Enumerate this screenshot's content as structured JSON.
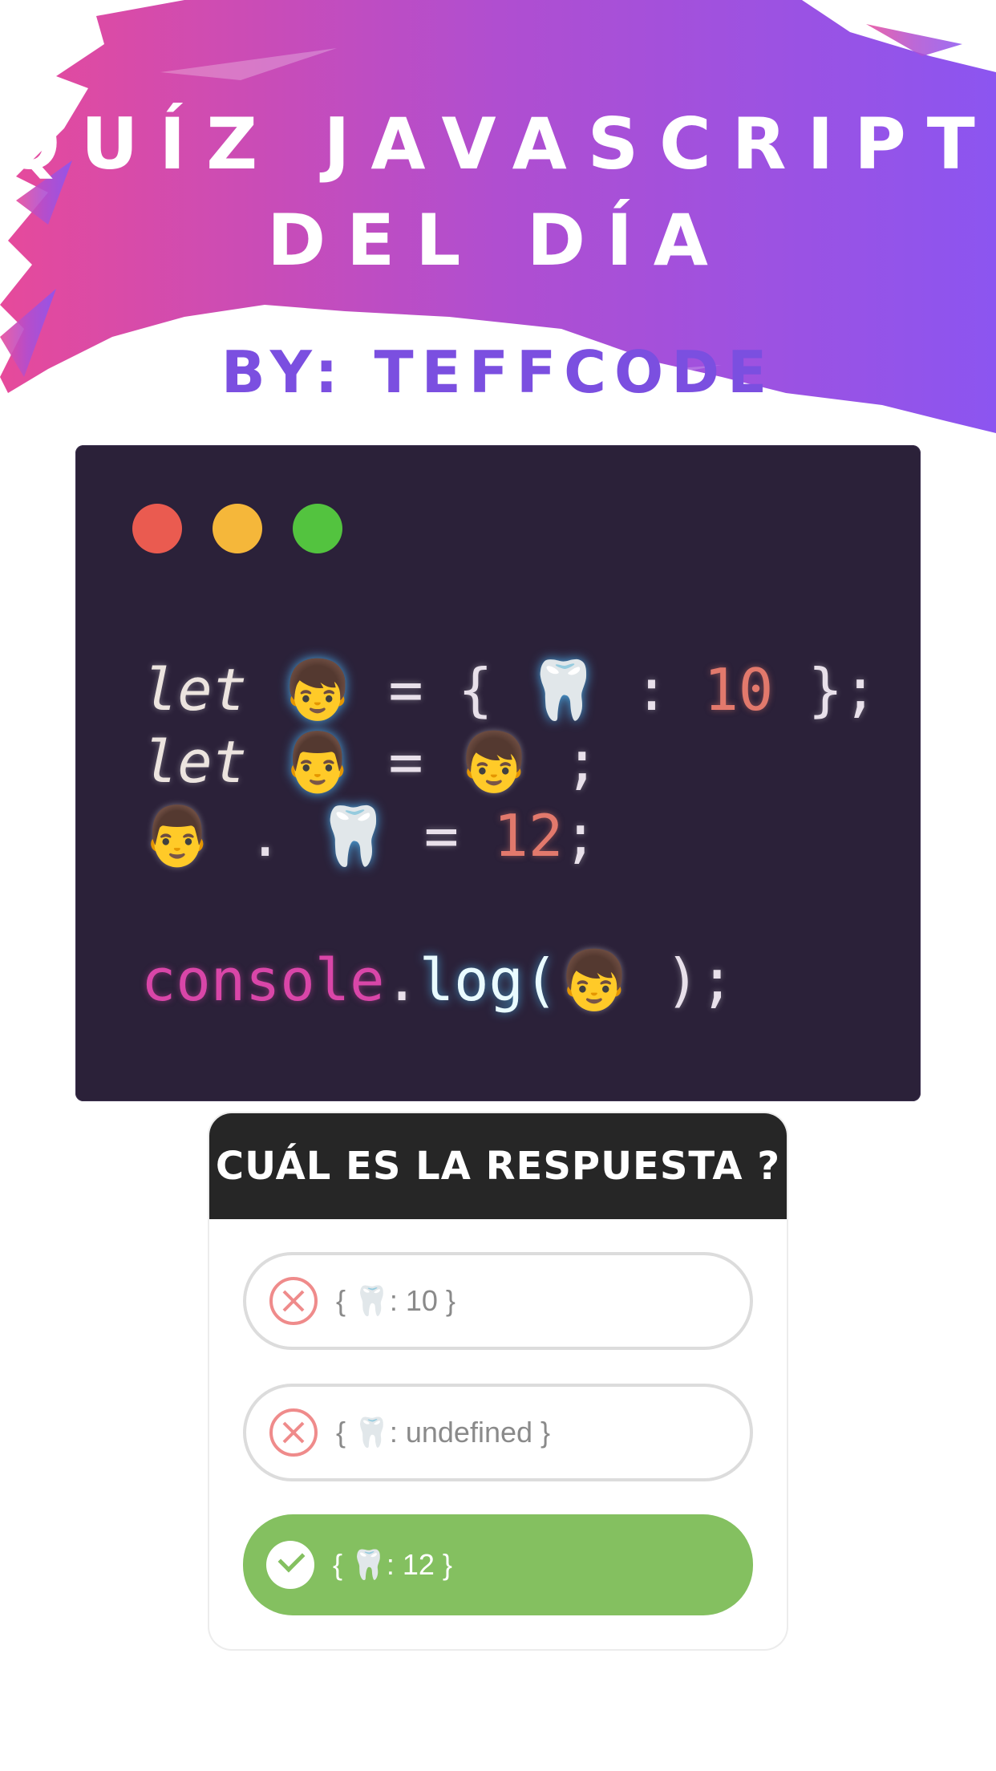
{
  "header": {
    "title_line1": "QUÍZ JAVASCRIPT",
    "title_line2": "DEL DÍA",
    "byline": "BY: TEFFCODE",
    "gradient_start": "#e64a9b",
    "gradient_end": "#8c55f0"
  },
  "code": {
    "window_dots": [
      "#ea5b50",
      "#f5b73a",
      "#53c33f"
    ],
    "line1": {
      "kw": "let",
      "var": "👦",
      "op": "= {",
      "key": "🦷",
      "sep": ":",
      "num": "10",
      "end": "};"
    },
    "line2": {
      "kw": "let",
      "var": "👨",
      "op": "=",
      "val": "👦",
      "end": ";"
    },
    "line3": {
      "obj": "👨",
      "dot": ".",
      "key": "🦷",
      "op": "=",
      "num": "12",
      "end": ";"
    },
    "line4": {
      "fn": "console",
      "dot": ".",
      "method": "log(",
      "arg": "👦",
      "end": ");"
    }
  },
  "quiz": {
    "question": "CUÁL ES LA RESPUESTA ?",
    "options": [
      {
        "label": "{ 🦷: 10 }",
        "state": "wrong"
      },
      {
        "label": "{ 🦷: undefined }",
        "state": "wrong"
      },
      {
        "label": "{ 🦷: 12 }",
        "state": "correct"
      }
    ],
    "correct_color": "#84c060",
    "wrong_color": "#ef8b8b"
  }
}
